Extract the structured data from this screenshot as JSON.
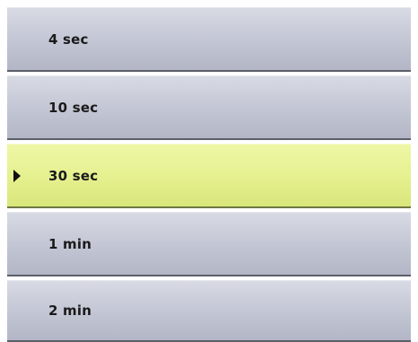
{
  "menu": {
    "selected_index": 2,
    "items": [
      {
        "label": "4 sec"
      },
      {
        "label": "10 sec"
      },
      {
        "label": "30 sec"
      },
      {
        "label": "1 min"
      },
      {
        "label": "2 min"
      }
    ]
  },
  "colors": {
    "item_background": "#c2c5d3",
    "selected_background": "#e5f08e",
    "separator": "#5c5f68",
    "text": "#1a1a1a"
  },
  "icons": {
    "selected_marker": "right-pointing-triangle"
  }
}
